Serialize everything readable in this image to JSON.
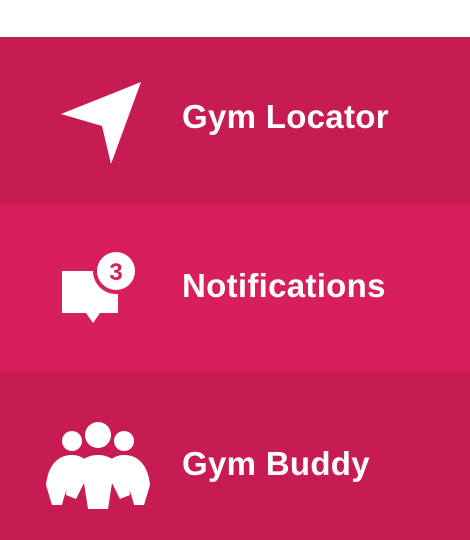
{
  "menu": {
    "items": [
      {
        "id": "gym-locator",
        "label": "Gym Locator",
        "icon": "navigation-arrow-icon"
      },
      {
        "id": "notifications",
        "label": "Notifications",
        "icon": "chat-bubble-icon",
        "badge": "3"
      },
      {
        "id": "gym-buddy",
        "label": "Gym Buddy",
        "icon": "muscle-group-icon"
      }
    ]
  },
  "colors": {
    "item_dark": "#c71c52",
    "item_light": "#d81f5d",
    "text": "#ffffff"
  }
}
